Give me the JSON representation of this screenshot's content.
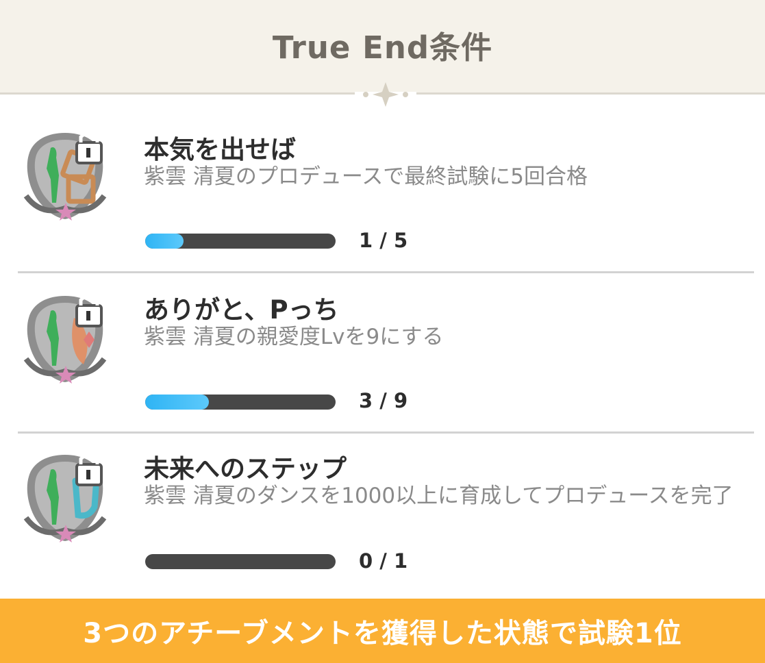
{
  "header": {
    "title": "True End条件"
  },
  "items": [
    {
      "title": "本気を出せば",
      "description": "紫雲 清夏のプロデュースで最終試験に5回合格",
      "progress_text": "1 / 5",
      "progress": 0.2,
      "accent": "#c98b55"
    },
    {
      "title": "ありがと、Pっち",
      "description": "紫雲 清夏の親愛度Lvを9にする",
      "progress_text": "3 / 9",
      "progress": 0.333,
      "accent": "#e58a5a"
    },
    {
      "title": "未来へのステップ",
      "description": "紫雲 清夏のダンスを1000以上に育成してプロデュースを完了",
      "progress_text": "0 / 1",
      "progress": 0.0,
      "accent": "#4bb8c9"
    }
  ],
  "footer": {
    "text": "3つのアチーブメントを獲得した状態で試験1位"
  },
  "colors": {
    "header_bg": "#f5f2ea",
    "footer_bg": "#fbb033",
    "progress_fill": "#2fb4f4",
    "progress_track": "#474747"
  }
}
